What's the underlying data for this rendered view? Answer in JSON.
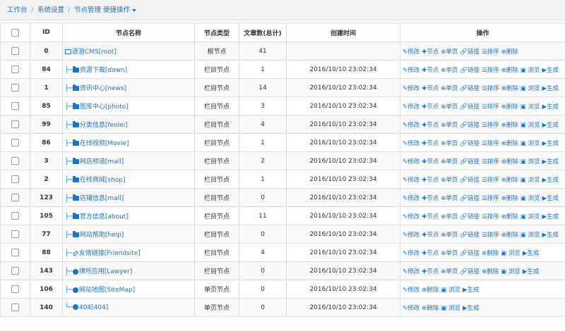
{
  "breadcrumb": {
    "home": "工作台",
    "sep": "/",
    "settings": "系统设置",
    "current": "节点管理 便捷操作"
  },
  "table": {
    "headers": {
      "id": "ID",
      "name": "节点名称",
      "type": "节点类型",
      "count": "文章数(总计)",
      "created": "创建时间",
      "actions": "操作"
    },
    "rows": [
      {
        "id": "0",
        "tree": "",
        "icon": "folder-open",
        "name": "逐浪CMS[root]",
        "type": "根节点",
        "count": "41",
        "created": "",
        "actions": [
          "✎修改",
          "✚节点",
          "⊕单页",
          "🔗链接",
          "☰排序",
          "⊗删除"
        ]
      },
      {
        "id": "84",
        "tree": "├─",
        "icon": "folder",
        "name": "资源下载[down]",
        "type": "栏目节点",
        "count": "1",
        "created": "2016/10/10 23:02:34",
        "actions": [
          "✎修改",
          "✚节点",
          "⊕单页",
          "🔗链接",
          "☰排序",
          "⊗删除",
          "▣ 浏览",
          "▶生成"
        ]
      },
      {
        "id": "1",
        "tree": "├─",
        "icon": "folder",
        "name": "资讯中心[news]",
        "type": "栏目节点",
        "count": "14",
        "created": "2016/10/10 23:02:34",
        "actions": [
          "✎修改",
          "✚节点",
          "⊕单页",
          "🔗链接",
          "☰排序",
          "⊗删除",
          "▣ 浏览",
          "▶生成"
        ]
      },
      {
        "id": "85",
        "tree": "├─",
        "icon": "folder",
        "name": "图库中心[photo]",
        "type": "栏目节点",
        "count": "3",
        "created": "2016/10/10 23:02:34",
        "actions": [
          "✎修改",
          "✚节点",
          "⊕单页",
          "🔗链接",
          "☰排序",
          "⊗删除",
          "▣ 浏览",
          "▶生成"
        ]
      },
      {
        "id": "99",
        "tree": "├─",
        "icon": "folder",
        "name": "分类信息[fenlei]",
        "type": "栏目节点",
        "count": "4",
        "created": "2016/10/10 23:02:34",
        "actions": [
          "✎修改",
          "✚节点",
          "⊕单页",
          "🔗链接",
          "☰排序",
          "⊗删除",
          "▣ 浏览",
          "▶生成"
        ]
      },
      {
        "id": "86",
        "tree": "├─",
        "icon": "folder",
        "name": "在线视频[Movie]",
        "type": "栏目节点",
        "count": "1",
        "created": "2016/10/10 23:02:34",
        "actions": [
          "✎修改",
          "✚节点",
          "⊕单页",
          "🔗链接",
          "☰排序",
          "⊗删除",
          "▣ 浏览",
          "▶生成"
        ]
      },
      {
        "id": "3",
        "tree": "├─",
        "icon": "folder",
        "name": "网店频道[mall]",
        "type": "栏目节点",
        "count": "2",
        "created": "2016/10/10 23:02:34",
        "actions": [
          "✎修改",
          "✚节点",
          "⊕单页",
          "🔗链接",
          "☰排序",
          "⊗删除",
          "▣ 浏览",
          "▶生成"
        ]
      },
      {
        "id": "2",
        "tree": "├─",
        "icon": "folder",
        "name": "在线商城[shop]",
        "type": "栏目节点",
        "count": "1",
        "created": "2016/10/10 23:02:34",
        "actions": [
          "✎修改",
          "✚节点",
          "⊕单页",
          "🔗链接",
          "☰排序",
          "⊗删除",
          "▣ 浏览",
          "▶生成"
        ]
      },
      {
        "id": "123",
        "tree": "├─",
        "icon": "folder",
        "name": "店铺信息[mall]",
        "type": "栏目节点",
        "count": "0",
        "created": "2016/10/10 23:02:34",
        "actions": [
          "✎修改",
          "✚节点",
          "⊕单页",
          "🔗链接",
          "☰排序",
          "⊗删除",
          "▣ 浏览",
          "▶生成"
        ]
      },
      {
        "id": "105",
        "tree": "├─",
        "icon": "folder",
        "name": "官方信息[about]",
        "type": "栏目节点",
        "count": "11",
        "created": "2016/10/10 23:02:34",
        "actions": [
          "✎修改",
          "✚节点",
          "⊕单页",
          "🔗链接",
          "☰排序",
          "⊗删除",
          "▣ 浏览",
          "▶生成"
        ]
      },
      {
        "id": "77",
        "tree": "├─",
        "icon": "folder",
        "name": "网站帮助[help]",
        "type": "栏目节点",
        "count": "0",
        "created": "2016/10/10 23:02:34",
        "actions": [
          "✎修改",
          "✚节点",
          "⊕单页",
          "🔗链接",
          "☰排序",
          "⊗删除",
          "▣ 浏览",
          "▶生成"
        ]
      },
      {
        "id": "88",
        "tree": "├─",
        "icon": "link",
        "name": "友情链接[Friendsite]",
        "type": "栏目节点",
        "count": "4",
        "created": "2016/10/10 23:02:34",
        "actions": [
          "✎修改",
          "✚节点",
          "⊕单页",
          "🔗链接",
          "⊗删除",
          "▣ 浏览",
          "▶生成"
        ]
      },
      {
        "id": "143",
        "tree": "├─",
        "icon": "globe",
        "name": "律所应用[Lawyer]",
        "type": "栏目节点",
        "count": "0",
        "created": "2016/10/10 23:02:34",
        "actions": [
          "✎修改",
          "✚节点",
          "⊕单页",
          "🔗链接",
          "⊗删除",
          "▣ 浏览",
          "▶生成"
        ]
      },
      {
        "id": "106",
        "tree": "├─",
        "icon": "globe",
        "name": "网站地图[SiteMap]",
        "type": "单页节点",
        "count": "0",
        "created": "2016/10/10 23:02:34",
        "actions": [
          "✎修改",
          "⊗删除",
          "▣ 浏览",
          "▶生成"
        ]
      },
      {
        "id": "140",
        "tree": "└─",
        "icon": "globe",
        "name": "404[404]",
        "type": "单页节点",
        "count": "0",
        "created": "2016/10/10 23:02:34",
        "actions": [
          "✎修改",
          "⊗删除",
          "▣ 浏览",
          "▶生成"
        ]
      }
    ]
  },
  "colors": {
    "link": "#1e73be",
    "border": "#dddddd",
    "stripe": "#f9f9f9",
    "topbar": "#f2f2f2"
  }
}
